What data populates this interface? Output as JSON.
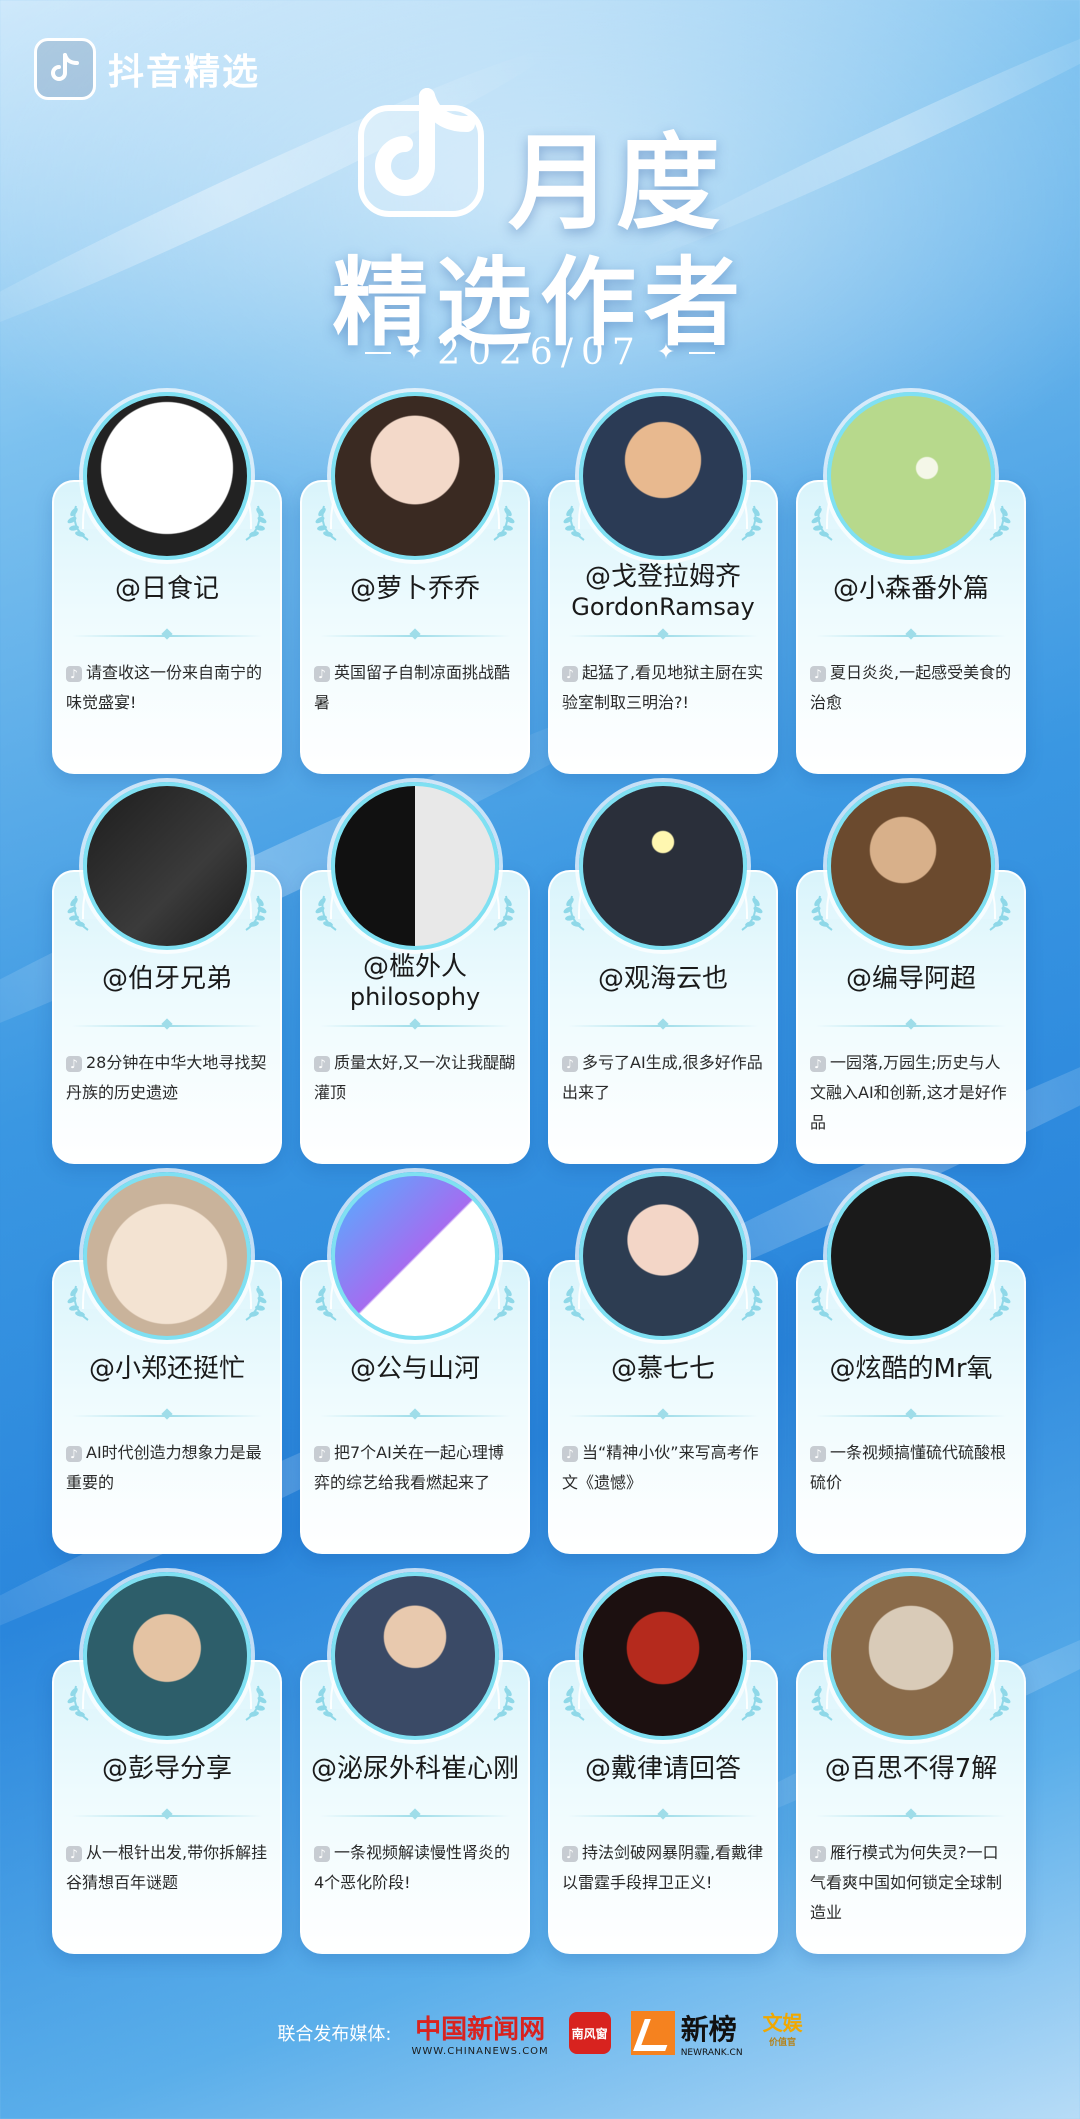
{
  "brand": {
    "name": "抖音精选"
  },
  "hero": {
    "title_line1": "月度",
    "title_line2": "精选作者",
    "date": "2026/07"
  },
  "authors": [
    {
      "name": "@日食记",
      "desc": "请查收这一份来自南宁的味觉盛宴!"
    },
    {
      "name": "@萝卜乔乔",
      "desc": "英国留子自制凉面挑战酷暑"
    },
    {
      "name": "@戈登拉姆齐GordonRamsay",
      "desc": "起猛了,看见地狱主厨在实验室制取三明治?!"
    },
    {
      "name": "@小森番外篇",
      "desc": "夏日炎炎,一起感受美食的治愈"
    },
    {
      "name": "@伯牙兄弟",
      "desc": "28分钟在中华大地寻找契丹族的历史遗迹"
    },
    {
      "name": "@槛外人philosophy",
      "desc": "质量太好,又一次让我醍醐灌顶"
    },
    {
      "name": "@观海云也",
      "desc": "多亏了AI生成,很多好作品出来了"
    },
    {
      "name": "@编导阿超",
      "desc": "一园落,万园生;历史与人文融入AI和创新,这才是好作品"
    },
    {
      "name": "@小郑还挺忙",
      "desc": "AI时代创造力想象力是最重要的"
    },
    {
      "name": "@公与山河",
      "desc": "把7个AI关在一起心理博弈的综艺给我看燃起来了"
    },
    {
      "name": "@慕七七",
      "desc": "当“精神小伙”来写高考作文《遗憾》"
    },
    {
      "name": "@炫酷的Mr氧",
      "desc": "一条视频搞懂硫代硫酸根硫价"
    },
    {
      "name": "@彭导分享",
      "desc": "从一根针出发,带你拆解挂谷猜想百年谜题"
    },
    {
      "name": "@泌尿外科崔心刚",
      "desc": "一条视频解读慢性肾炎的4个恶化阶段!"
    },
    {
      "name": "@戴律请回答",
      "desc": "持法剑破网暴阴霾,看戴律以雷霆手段捍卫正义!"
    },
    {
      "name": "@百思不得7解",
      "desc": "雁行模式为何失灵?一口气看爽中国如何锁定全球制造业"
    }
  ],
  "footer": {
    "label": "联合发布媒体:",
    "chinanews": "中国新闻网",
    "chinanews_url": "WWW.CHINANEWS.COM",
    "nanfengchuang": "南风窗",
    "newrank": "新榜",
    "newrank_url": "NEWRANK.CN",
    "wenyu": "文娱",
    "wenyu_sub": "价值官"
  }
}
